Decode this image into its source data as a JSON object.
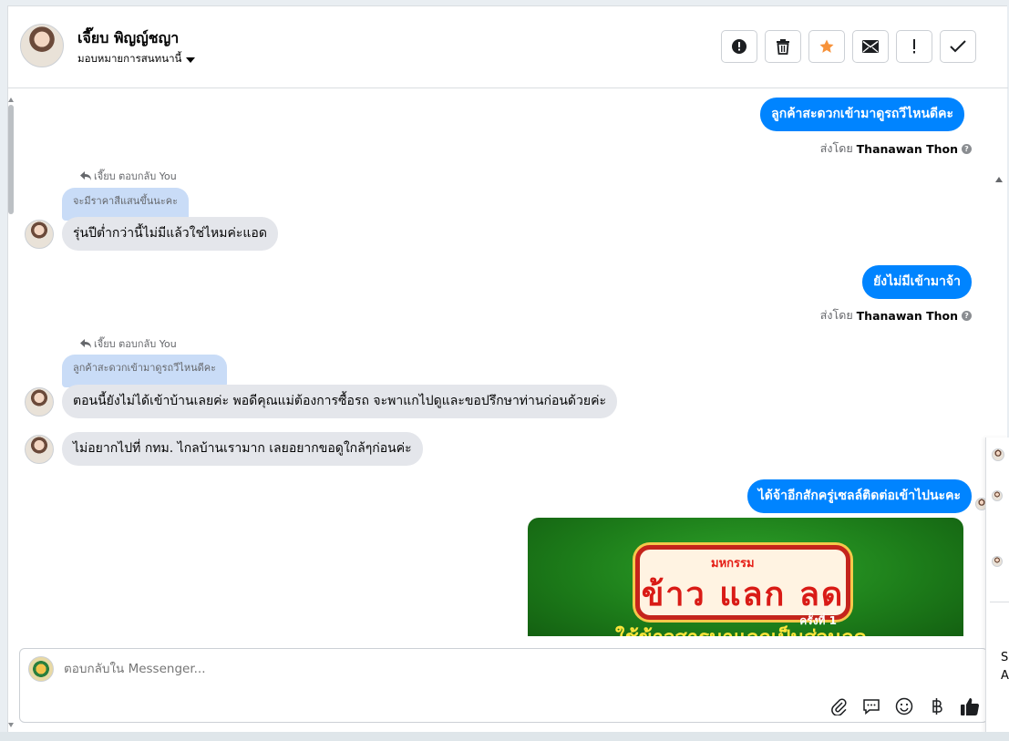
{
  "header": {
    "name": "เจี๊ยบ พิญญ์ชญา",
    "assign_label": "มอบหมายการสนทนานี้",
    "actions": [
      {
        "icon": "alert-circle-icon"
      },
      {
        "icon": "trash-icon"
      },
      {
        "icon": "star-icon",
        "color": "#f7923a"
      },
      {
        "icon": "mail-icon"
      },
      {
        "icon": "exclamation-icon"
      },
      {
        "icon": "check-icon"
      }
    ]
  },
  "messages": {
    "m1": {
      "text": "ลูกค้าสะดวกเข้ามาดูรถวีไหนดีคะ",
      "sent_by_prefix": "ส่งโดย",
      "sent_by_name": "Thanawan Thon"
    },
    "r1": {
      "reply_meta": "เจี๊ยบ ตอบกลับ You",
      "quote": "จะมีราคาสีแสนขึ้นนะคะ",
      "text": "รุ่นปีต่ำกว่านี้ไม่มีแล้วใช่ไหมค่ะแอด"
    },
    "m2": {
      "text": "ยังไม่มีเข้ามาจ้า",
      "sent_by_prefix": "ส่งโดย",
      "sent_by_name": "Thanawan Thon"
    },
    "r2": {
      "reply_meta": "เจี๊ยบ ตอบกลับ You",
      "quote": "ลูกค้าสะดวกเข้ามาดูรถวีไหนดีคะ",
      "text": "ตอนนี้ยังไม่ได้เข้าบ้านเลยค่ะ พอดีคุณแม่ต้องการซื้อรถ จะพาแกไปดูและขอปรึกษาท่านก่อนด้วยค่ะ"
    },
    "r3": {
      "text": "ไม่อยากไปที่ กทม. ไกลบ้านเรามาก เลยอยากขอดูใกล้ๆก่อนค่ะ"
    },
    "m3": {
      "text": "ได้จ้าอีกสักครู่เซลล์ติดต่อเข้าไปนะคะ"
    },
    "promo": {
      "top": "มหกรรม",
      "main": "ข้าว แลก ลด",
      "sub": "ครั้งที่ 1",
      "bottom": "ใช้ข้าวสารมาแลกเป็นส่วนลด"
    }
  },
  "composer": {
    "placeholder": "ตอบกลับใน Messenger...",
    "tools": [
      "paperclip-icon",
      "chat-bubble-icon",
      "emoji-icon",
      "baht-icon",
      "thumbs-up-icon"
    ]
  },
  "side": {
    "t1": "Sc",
    "t2": "A"
  },
  "colors": {
    "accent": "#0084ff",
    "incoming": "#e4e6eb",
    "quote": "#c9dcf7"
  }
}
